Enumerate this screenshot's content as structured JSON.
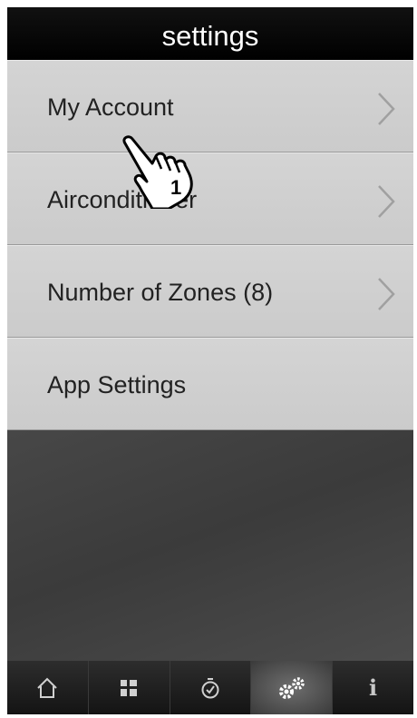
{
  "header": {
    "title": "settings"
  },
  "menu": {
    "items": [
      {
        "label": "My Account",
        "chevron": true
      },
      {
        "label": "Airconditioner",
        "chevron": true
      },
      {
        "label": "Number of Zones (8)",
        "chevron": true
      },
      {
        "label": "App Settings",
        "chevron": false
      }
    ]
  },
  "annotation": {
    "step": "1",
    "icon": "pointing-hand-icon"
  },
  "tabbar": {
    "tabs": [
      {
        "icon": "home-icon",
        "active": false
      },
      {
        "icon": "zones-grid-icon",
        "active": false
      },
      {
        "icon": "timer-icon",
        "active": false
      },
      {
        "icon": "settings-gears-icon",
        "active": true
      },
      {
        "icon": "info-icon",
        "label": "i",
        "active": false
      }
    ]
  }
}
